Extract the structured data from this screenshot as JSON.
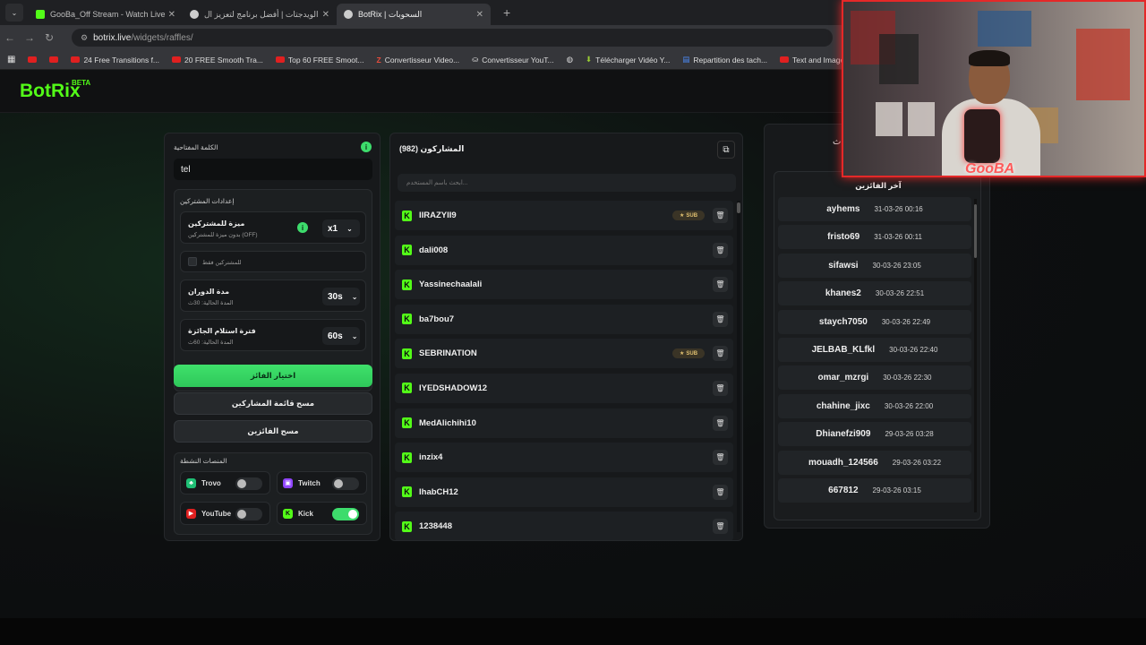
{
  "browser": {
    "tabs": [
      {
        "title": "GooBa_Off Stream - Watch Live",
        "color": "#53fc18"
      },
      {
        "title": "الويدجتات | أفضل برنامج لتعزيز ال",
        "color": "#cccccc"
      },
      {
        "title": "BotRix | السحوبات",
        "color": "#cccccc"
      }
    ],
    "url_host": "botrix.live",
    "url_path": "/widgets/raffles/",
    "bookmarks": [
      "24 Free Transitions f...",
      "20 FREE Smooth Tra...",
      "Top 60 FREE Smoot...",
      "Convertisseur Video...",
      "Convertisseur YouT...",
      "Télécharger Vidéo Y...",
      "Repartition des tach...",
      "Text and Image ani..."
    ]
  },
  "logo": {
    "name": "BotRix",
    "badge": "BETA"
  },
  "left": {
    "keyword_label": "الكلمة المفتاحية",
    "keyword_value": "tel",
    "settings_title": "إعدادات المشتركين",
    "sub_bonus_title": "ميزة للمشتركين",
    "sub_bonus_sub": "بدون ميزة للمشتركين (OFF)",
    "sub_bonus_value": "x1",
    "subs_only": "للمشتركين فقط",
    "spin_title": "مدة الدوران",
    "spin_sub": "المدة الحالية: 30ث",
    "spin_value": "30s",
    "claim_title": "فترة استلام الجائزة",
    "claim_sub": "المدة الحالية: 60ث",
    "claim_value": "60s",
    "pick_winner": "اختيار الفائز",
    "clear_participants": "مسح قائمة المشاركين",
    "clear_winners": "مسح الفائزين",
    "platforms_title": "المنصات النشطة",
    "platforms": [
      {
        "name": "Trovo",
        "on": false,
        "color": "#1fbf75"
      },
      {
        "name": "Twitch",
        "on": false,
        "color": "#9146ff"
      },
      {
        "name": "YouTube",
        "on": false,
        "color": "#e02020"
      },
      {
        "name": "Kick",
        "on": true,
        "color": "#53fc18"
      }
    ]
  },
  "participants": {
    "title": "المشاركون (982)",
    "search_placeholder": "ابحث باسم المستخدم...",
    "sub_label": "SUB",
    "items": [
      {
        "name": "IIRAZYII9",
        "sub": true
      },
      {
        "name": "dali008",
        "sub": false
      },
      {
        "name": "Yassinechaalali",
        "sub": false
      },
      {
        "name": "ba7bou7",
        "sub": false
      },
      {
        "name": "SEBRINATION",
        "sub": true
      },
      {
        "name": "IYEDSHADOW12",
        "sub": false
      },
      {
        "name": "MedAlichihi10",
        "sub": false
      },
      {
        "name": "inzix4",
        "sub": false
      },
      {
        "name": "IhabCH12",
        "sub": false
      },
      {
        "name": "1238448",
        "sub": false
      }
    ]
  },
  "winners": {
    "top_fragment": "ث",
    "title": "آخر الفائزين",
    "items": [
      {
        "name": "ayhems",
        "date": "31-03-26 00:16"
      },
      {
        "name": "fristo69",
        "date": "31-03-26 00:11"
      },
      {
        "name": "sifawsi",
        "date": "30-03-26 23:05"
      },
      {
        "name": "khanes2",
        "date": "30-03-26 22:51"
      },
      {
        "name": "staych7050",
        "date": "30-03-26 22:49"
      },
      {
        "name": "JELBAB_KLfkl",
        "date": "30-03-26 22:40"
      },
      {
        "name": "omar_mzrgi",
        "date": "30-03-26 22:30"
      },
      {
        "name": "chahine_jixc",
        "date": "30-03-26 22:00"
      },
      {
        "name": "Dhianefzi909",
        "date": "29-03-26 03:28"
      },
      {
        "name": "mouadh_124566",
        "date": "29-03-26 03:22"
      },
      {
        "name": "667812",
        "date": "29-03-26 03:15"
      }
    ]
  },
  "webcam": {
    "overlay": "GooBA"
  }
}
